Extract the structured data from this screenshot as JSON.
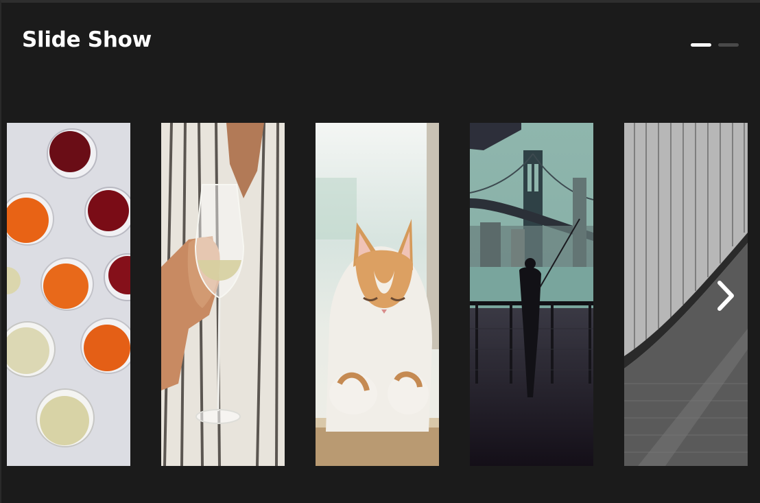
{
  "header": {
    "title": "Slide Show"
  },
  "pager": {
    "pages": 2,
    "active_index": 0
  },
  "slides": [
    {
      "subject": "wine-glasses-photo"
    },
    {
      "subject": "person-holding-wine-glass-photo"
    },
    {
      "subject": "sleeping-cat-photo"
    },
    {
      "subject": "bridge-fisherman-photo"
    },
    {
      "subject": "grey-architecture-photo"
    }
  ],
  "navigation": {
    "next_icon": "chevron-right-icon"
  },
  "colors": {
    "background": "#1b1b1b",
    "title": "#ffffff",
    "pager_active": "#ffffff",
    "pager_inactive": "#4a4a4a"
  }
}
